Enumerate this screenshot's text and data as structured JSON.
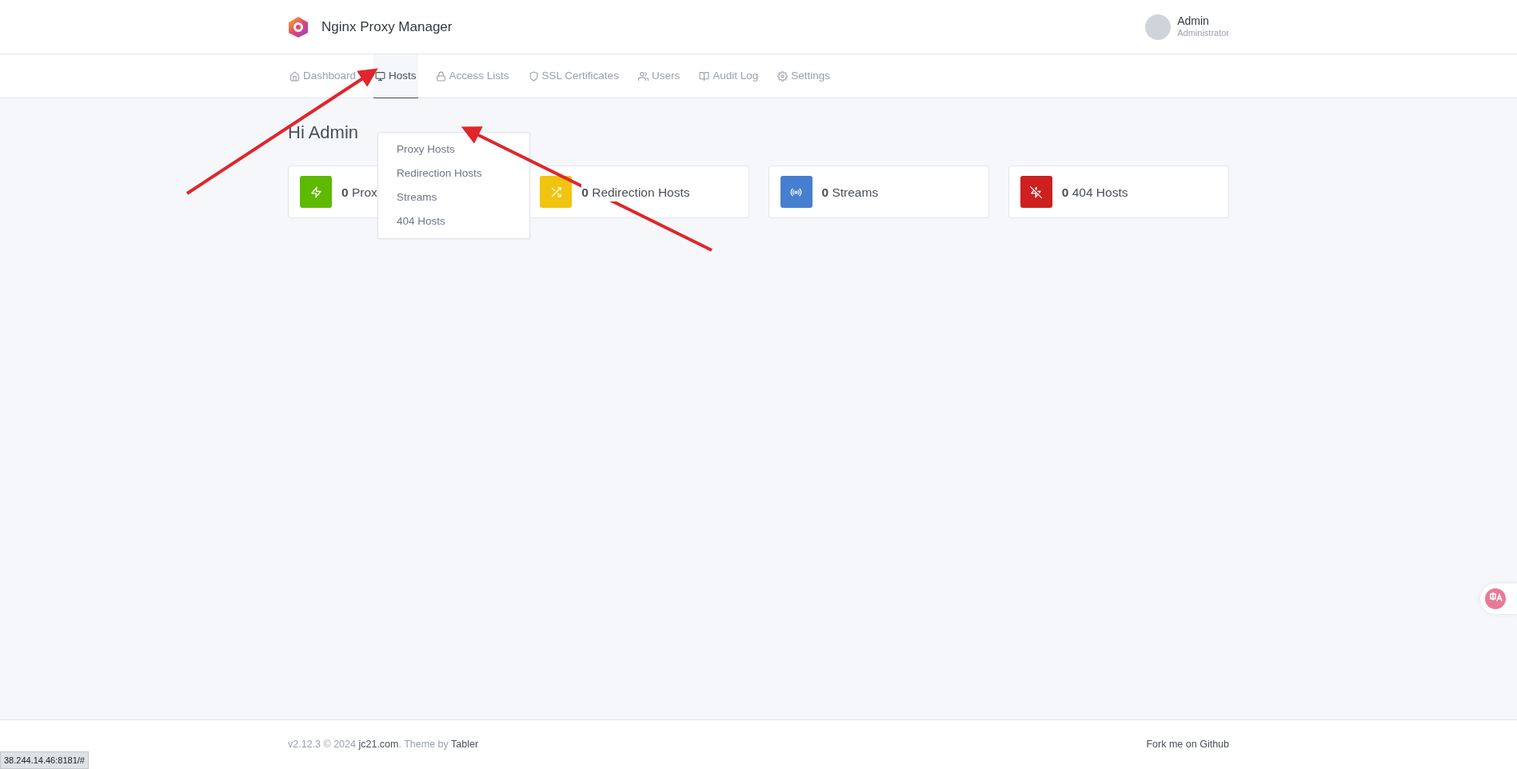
{
  "header": {
    "brand": "Nginx Proxy Manager",
    "user": {
      "name": "Admin",
      "role": "Administrator"
    }
  },
  "nav": [
    {
      "label": "Dashboard",
      "selected": false
    },
    {
      "label": "Hosts",
      "selected": true
    },
    {
      "label": "Access Lists",
      "selected": false
    },
    {
      "label": "SSL Certificates",
      "selected": false
    },
    {
      "label": "Users",
      "selected": false
    },
    {
      "label": "Audit Log",
      "selected": false
    },
    {
      "label": "Settings",
      "selected": false
    }
  ],
  "dropdown": {
    "items": [
      "Proxy Hosts",
      "Redirection Hosts",
      "Streams",
      "404 Hosts"
    ]
  },
  "greeting": "Hi Admin",
  "cards": [
    {
      "count": "0",
      "label": "Prox",
      "color": "#5eba00"
    },
    {
      "count": "0",
      "label": "Redirection Hosts",
      "color": "#f1c40f"
    },
    {
      "count": "0",
      "label": "Streams",
      "color": "#467fcf"
    },
    {
      "count": "0",
      "label": "404 Hosts",
      "color": "#cd201f"
    }
  ],
  "footer": {
    "parts": [
      {
        "kind": "text",
        "text": "v2.12.3 © 2024 "
      },
      {
        "kind": "link",
        "text": "jc21.com"
      },
      {
        "kind": "text",
        "text": ". Theme by "
      },
      {
        "kind": "link",
        "text": "Tabler"
      }
    ],
    "right": "Fork me on Github"
  },
  "status_bar": {
    "url": "38.244.14.46:8181/#"
  }
}
